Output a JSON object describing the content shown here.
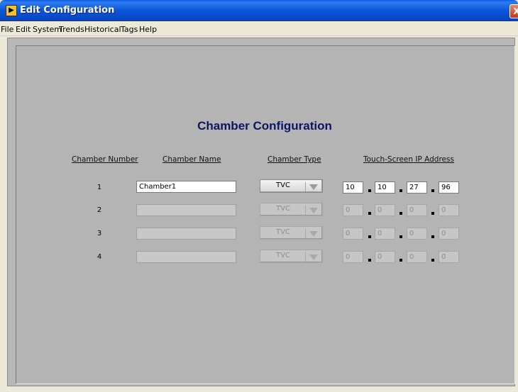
{
  "window": {
    "title": "Edit Configuration",
    "close_glyph": "X"
  },
  "menu": [
    "File",
    "Edit",
    "System",
    "Trends",
    "Historical",
    "Tags",
    "Help"
  ],
  "heading": "Chamber Configuration",
  "columns": {
    "number": "Chamber Number",
    "name": "Chamber Name",
    "type": "Chamber Type",
    "ip": "Touch-Screen IP Address"
  },
  "rows": [
    {
      "number": "1",
      "name": "Chamber1",
      "type": "TVC",
      "ip": [
        "10",
        "10",
        "27",
        "96"
      ],
      "enabled": true
    },
    {
      "number": "2",
      "name": "",
      "type": "TVC",
      "ip": [
        "0",
        "0",
        "0",
        "0"
      ],
      "enabled": false
    },
    {
      "number": "3",
      "name": "",
      "type": "TVC",
      "ip": [
        "0",
        "0",
        "0",
        "0"
      ],
      "enabled": false
    },
    {
      "number": "4",
      "name": "",
      "type": "TVC",
      "ip": [
        "0",
        "0",
        "0",
        "0"
      ],
      "enabled": false
    }
  ],
  "icons": {
    "app": "labview-app-icon",
    "type_dropdown": "dropdown-arrow-icon"
  },
  "colors": {
    "heading": "#0b1660",
    "titlebar": "#0b56d8",
    "panel": "#b4b4b4"
  }
}
